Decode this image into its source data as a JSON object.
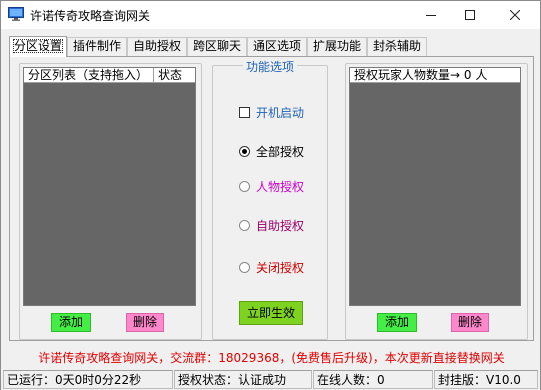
{
  "window": {
    "title": "许诺传奇攻略查询网关"
  },
  "tabs": [
    {
      "label": "分区设置",
      "active": true
    },
    {
      "label": "插件制作"
    },
    {
      "label": "自助授权"
    },
    {
      "label": "跨区聊天"
    },
    {
      "label": "通区选项"
    },
    {
      "label": "扩展功能"
    },
    {
      "label": "封杀辅助"
    }
  ],
  "left_panel": {
    "columns": [
      "分区列表（支持拖入）",
      "状态"
    ],
    "add_label": "添加",
    "delete_label": "删除"
  },
  "options": {
    "legend": "功能选项",
    "autostart_label": "开机启动",
    "autostart_checked": false,
    "radios": [
      {
        "label": "全部授权",
        "checked": true,
        "color": "#000000"
      },
      {
        "label": "人物授权",
        "checked": false,
        "color": "#cc00cc"
      },
      {
        "label": "自助授权",
        "checked": false,
        "color": "#990066"
      },
      {
        "label": "关闭授权",
        "checked": false,
        "color": "#cc0000"
      }
    ],
    "apply_label": "立即生效"
  },
  "right_panel": {
    "header": "授权玩家人物数量→  0 人",
    "add_label": "添加",
    "delete_label": "删除"
  },
  "footer_note": "许诺传奇攻略查询网关，交流群：18029368，(免费售后升级)，本次更新直接替换网关",
  "status": {
    "uptime": "已运行：0天0时0分22秒",
    "auth": "授权状态：认证成功",
    "online": "在线人数：0",
    "version": "封挂版：V10.0"
  },
  "colors": {
    "legend": "#1f63b5",
    "green_button": "#44ee44",
    "pink_button": "#ff88cc",
    "apply_button": "#7ed321",
    "footer_text": "#e00000",
    "list_background": "#666666"
  }
}
